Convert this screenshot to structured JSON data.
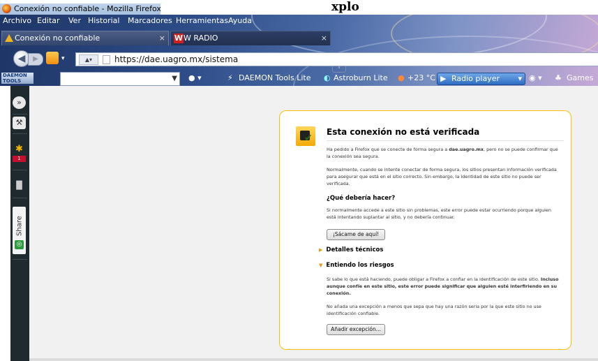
{
  "window": {
    "title": "Conexión no confiable - Mozilla Firefox"
  },
  "overflow_text": "xplo",
  "menu": [
    "Archivo",
    "Editar",
    "Ver",
    "Historial",
    "Marcadores",
    "Herramientas",
    "Ayuda"
  ],
  "tabs": [
    {
      "label": "Conexión no confiable",
      "close": "×"
    },
    {
      "label": "W RADIO",
      "close": "×"
    }
  ],
  "url": "https://dae.uagro.mx/sistema",
  "daemon_toolbar": {
    "logo": "DAEMON TOOLS",
    "tools_label": "DAEMON Tools Lite",
    "astro_label": "Astroburn Lite",
    "weather": "+23 °C",
    "radio": "Radio player",
    "games": "Games"
  },
  "sidebar": {
    "badge": "1",
    "share": "Share"
  },
  "error_page": {
    "title": "Esta conexión no está verificada",
    "p1_pre": "Ha pedido a Firefox que se conecte de forma segura a ",
    "p1_bold": "dae.uagro.mx",
    "p1_post": ", pero no se puede confirmar que la conexión sea segura.",
    "p2": "Normalmente, cuando se intente conectar de forma segura, los sitios presentan información verificada para asegurar que está en el sitio correcto. Sin embargo, la identidad de este sitio no puede ser verificada.",
    "h_what": "¿Qué debería hacer?",
    "p3": "Si normalmente accede a este sitio sin problemas, este error puede estar ocurriendo porque alguien está intentando suplantar al sitio, y no debería continuar.",
    "btn_leave": "¡Sácame de aquí!",
    "tech": "Detalles técnicos",
    "risks": "Entiendo los riesgos",
    "p4_pre": "Si sabe lo que está haciendo, puede obligar a Firefox a confiar en la identificación de este sitio. ",
    "p4_bold": "Incluso aunque confíe en este sitio, este error puede significar que alguien esté interfiriendo en su conexión.",
    "p5": "No añada una excepción a menos que sepa que hay una razón seria por la que este sitio no use identificación confiable.",
    "btn_exception": "Añadir excepción..."
  }
}
